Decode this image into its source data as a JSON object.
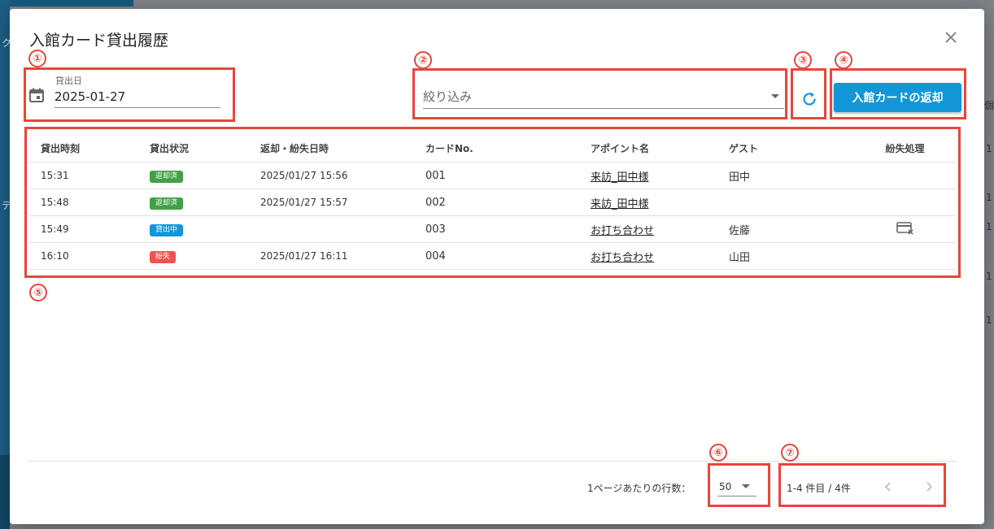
{
  "dialog": {
    "title": "入館カード貸出履歴"
  },
  "backdrop": {
    "left_top_char": "ク",
    "left_mid_char": "テ",
    "right_chars": [
      "個",
      "1",
      "1",
      "1",
      "1",
      "1"
    ]
  },
  "date_field": {
    "label": "貸出日",
    "value": "2025-01-27"
  },
  "filter": {
    "placeholder": "絞り込み"
  },
  "return_button": {
    "label": "入館カードの返却"
  },
  "callouts": [
    "①",
    "②",
    "③",
    "④",
    "⑤",
    "⑥",
    "⑦"
  ],
  "table": {
    "headers": [
      "貸出時刻",
      "貸出状況",
      "返却・紛失日時",
      "カードNo.",
      "アポイント名",
      "ゲスト",
      "紛失処理"
    ],
    "rows": [
      {
        "time": "15:31",
        "status": "返却済",
        "status_color": "#43a047",
        "returned": "2025/01/27 15:56",
        "card": "001",
        "appointment": "来訪_田中様",
        "guest": "田中",
        "lost_action": false
      },
      {
        "time": "15:48",
        "status": "返却済",
        "status_color": "#43a047",
        "returned": "2025/01/27 15:57",
        "card": "002",
        "appointment": "来訪_田中様",
        "guest": "",
        "lost_action": false
      },
      {
        "time": "15:49",
        "status": "貸出中",
        "status_color": "#1296d8",
        "returned": "",
        "card": "003",
        "appointment": "お打ち合わせ",
        "guest": "佐藤",
        "lost_action": true
      },
      {
        "time": "16:10",
        "status": "紛失",
        "status_color": "#ef5350",
        "returned": "2025/01/27 16:11",
        "card": "004",
        "appointment": "お打ち合わせ",
        "guest": "山田",
        "lost_action": false
      }
    ]
  },
  "pagination": {
    "rows_per_page_label": "1ページあたりの行数：",
    "rows_per_page": "50",
    "range": "1-4 件目 / 4件"
  },
  "colors": {
    "accent": "#1296d8",
    "callout": "#e8463a"
  },
  "icons": {
    "calendar": "calendar-icon",
    "refresh": "refresh-icon",
    "close": "close-icon",
    "lost": "card-lost-icon",
    "prev": "chevron-left-icon",
    "next": "chevron-right-icon"
  }
}
